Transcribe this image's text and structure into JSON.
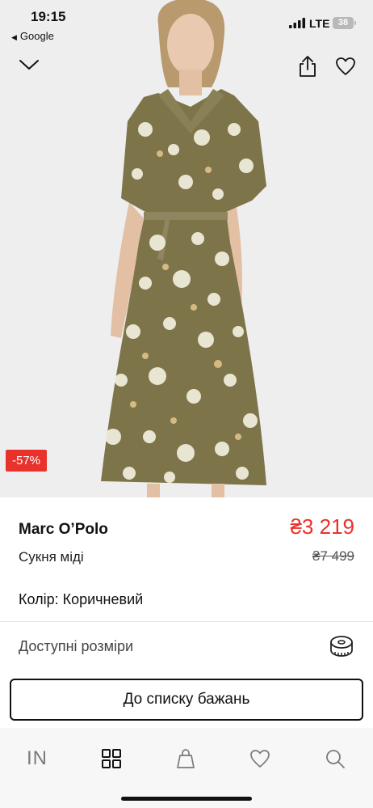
{
  "status_bar": {
    "time": "19:15",
    "back_app": "Google",
    "network": "LTE",
    "battery": "38"
  },
  "icons": {
    "collapse": "chevron-down-icon",
    "share": "share-icon",
    "favorite": "heart-icon",
    "size_guide": "measuring-tape-icon"
  },
  "product": {
    "discount_badge": "-57%",
    "brand": "Marc O’Polo",
    "category": "Сукня міді",
    "price": "₴3 219",
    "old_price": "₴7 499",
    "color_line": "Колір: Коричневий",
    "sizes_label": "Доступні розміри",
    "wishlist_button": "До списку бажань"
  },
  "tabbar": {
    "items": [
      {
        "label": "IN",
        "icon": "brand-logo"
      },
      {
        "icon": "catalog-grid-icon"
      },
      {
        "icon": "shopping-bag-icon"
      },
      {
        "icon": "heart-icon"
      },
      {
        "icon": "search-icon"
      }
    ]
  },
  "colors": {
    "accent_red": "#e8322b",
    "text": "#111111",
    "tab_icon": "#7a7a7a",
    "dress_olive": "#7e744a",
    "background": "#eeeeee"
  }
}
